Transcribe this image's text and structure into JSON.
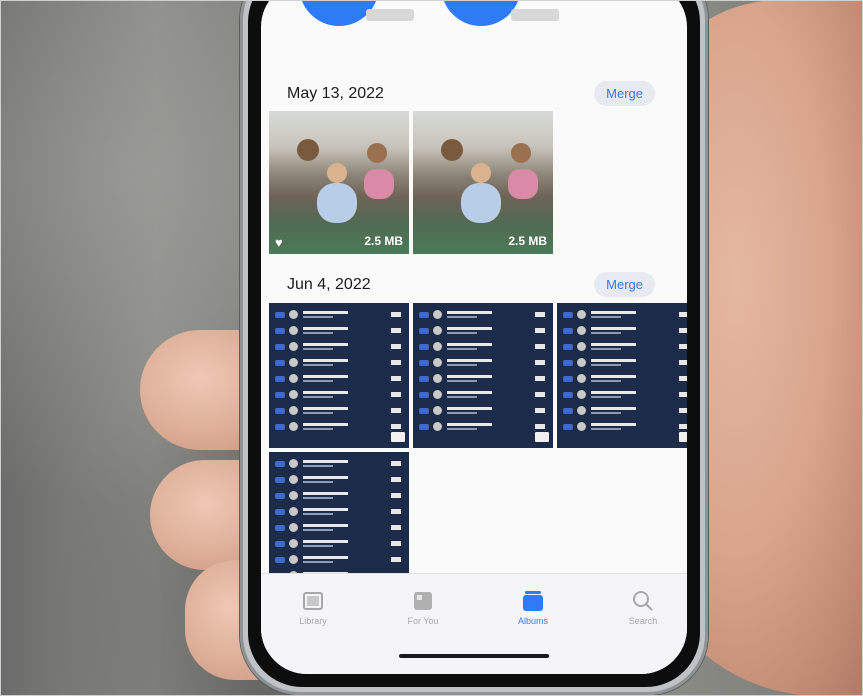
{
  "sections": [
    {
      "date": "May 13, 2022",
      "merge_label": "Merge",
      "photos": [
        {
          "size": "2.5 MB"
        },
        {
          "size": "2.5 MB"
        }
      ]
    },
    {
      "date": "Jun 4, 2022",
      "merge_label": "Merge"
    }
  ],
  "tabs": [
    {
      "label": "Library",
      "icon": "library-icon",
      "active": false
    },
    {
      "label": "For You",
      "icon": "for-you-icon",
      "active": false
    },
    {
      "label": "Albums",
      "icon": "albums-icon",
      "active": true
    },
    {
      "label": "Search",
      "icon": "search-icon",
      "active": false
    }
  ],
  "colors": {
    "accent": "#2f7bf5",
    "screenshot_bg": "#1d2b4a",
    "screen_bg": "#fafafa"
  }
}
